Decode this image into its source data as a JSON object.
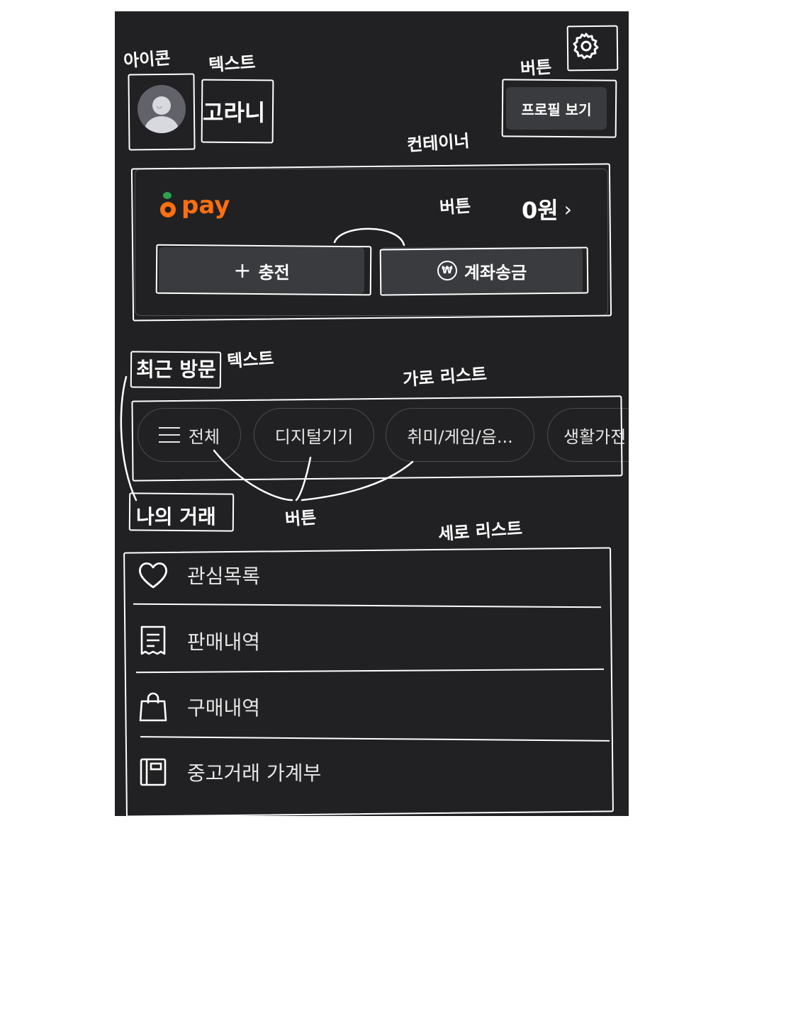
{
  "annotations": {
    "icon": "아이콘",
    "text_top": "텍스트",
    "button_top": "버튼",
    "container": "컨테이너",
    "button_pay": "버튼",
    "text_recent": "텍스트",
    "horizontal_list": "가로 리스트",
    "button_chips": "버튼",
    "vertical_list": "세로 리스트"
  },
  "profile": {
    "nickname": "고라니",
    "view_profile_label": "프로필 보기"
  },
  "pay": {
    "brand": "pay",
    "balance": "0원",
    "charge_label": "충전",
    "transfer_label": "계좌송금",
    "accent_color": "#ff6f0f"
  },
  "recent": {
    "title": "최근 방문",
    "chips": [
      {
        "label": "전체",
        "icon": "menu-icon"
      },
      {
        "label": "디지털기기"
      },
      {
        "label": "취미/게임/음..."
      },
      {
        "label": "생활가전"
      }
    ]
  },
  "my_trades": {
    "title": "나의 거래",
    "items": [
      {
        "label": "관심목록",
        "icon": "heart-icon"
      },
      {
        "label": "판매내역",
        "icon": "receipt-icon"
      },
      {
        "label": "구매내역",
        "icon": "shopping-bag-icon"
      },
      {
        "label": "중고거래 가계부",
        "icon": "ledger-book-icon"
      }
    ]
  },
  "colors": {
    "background": "#212123",
    "surface": "#3a3b3f",
    "text": "#ffffff"
  }
}
